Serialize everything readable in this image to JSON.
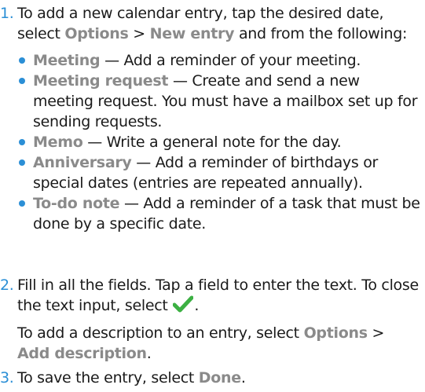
{
  "steps": [
    {
      "number": "1.",
      "intro": "To add a new calendar entry, tap the desired date, select",
      "menu1": "Options",
      "sep": ">",
      "menu2": "New entry",
      "intro_end": "and from the following:",
      "options": [
        {
          "name": "Meeting",
          "desc": "— Add a reminder of your meeting."
        },
        {
          "name": "Meeting request",
          "desc": "— Create and send a new meeting request. You must have a mailbox set up for sending requests."
        },
        {
          "name": "Memo",
          "desc": "— Write a general note for the day."
        },
        {
          "name": "Anniversary",
          "desc": "— Add a reminder of birthdays or special dates (entries are repeated annually)."
        },
        {
          "name": "To-do note",
          "desc": "— Add a reminder of a task that must be done by a specific date."
        }
      ]
    },
    {
      "number": "2.",
      "text": "Fill in all the fields. Tap a field to enter the text. To close the text input, select",
      "text_end": ".",
      "check_icon": "checkmark-icon",
      "check_color": "#3cb043",
      "desc_text": "To add a description to an entry, select",
      "menu1": "Options",
      "sep": ">",
      "menu2": "Add description",
      "desc_end": "."
    },
    {
      "number": "3.",
      "text": "To save the entry, select",
      "menu": "Done",
      "text_end": "."
    }
  ],
  "colors": {
    "number": "#2b8fd6",
    "ui_term": "#8a8a8a",
    "bullet": "#2b8fd6"
  }
}
